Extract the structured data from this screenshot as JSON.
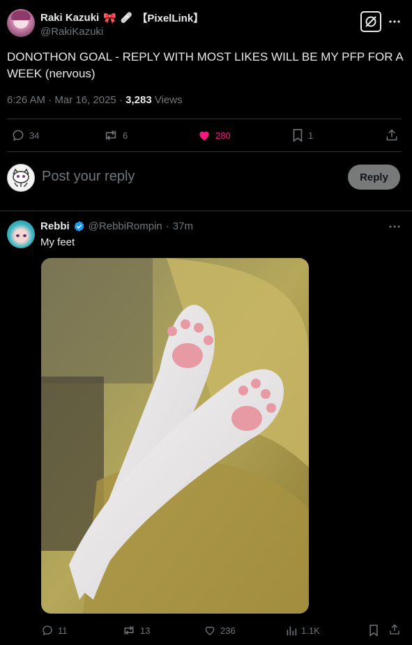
{
  "post": {
    "display_name": "Raki Kazuki",
    "name_tag": "【PixelLink】",
    "handle": "@RakiKazuki",
    "text": "DONOTHON GOAL - REPLY WITH MOST LIKES WILL BE MY PFP FOR A WEEK (nervous)",
    "time": "6:26 AM",
    "date": "Mar 16, 2025",
    "views_count": "3,283",
    "views_label": "Views",
    "stats": {
      "replies": "34",
      "reposts": "6",
      "likes": "280",
      "bookmarks": "1"
    },
    "like_color": "#f91880"
  },
  "composer": {
    "placeholder": "Post your reply",
    "button_label": "Reply"
  },
  "reply": {
    "display_name": "Rebbi",
    "handle": "@RebbiRompin",
    "time_ago": "37m",
    "text": "My feet",
    "stats": {
      "replies": "11",
      "reposts": "13",
      "likes": "236",
      "views": "1.1K"
    },
    "verified_color": "#1d9bf0"
  },
  "icons": [
    "grok-icon",
    "more-icon",
    "reply-icon",
    "repost-icon",
    "heart-icon",
    "bookmark-icon",
    "share-icon",
    "analytics-icon",
    "verified-icon"
  ]
}
